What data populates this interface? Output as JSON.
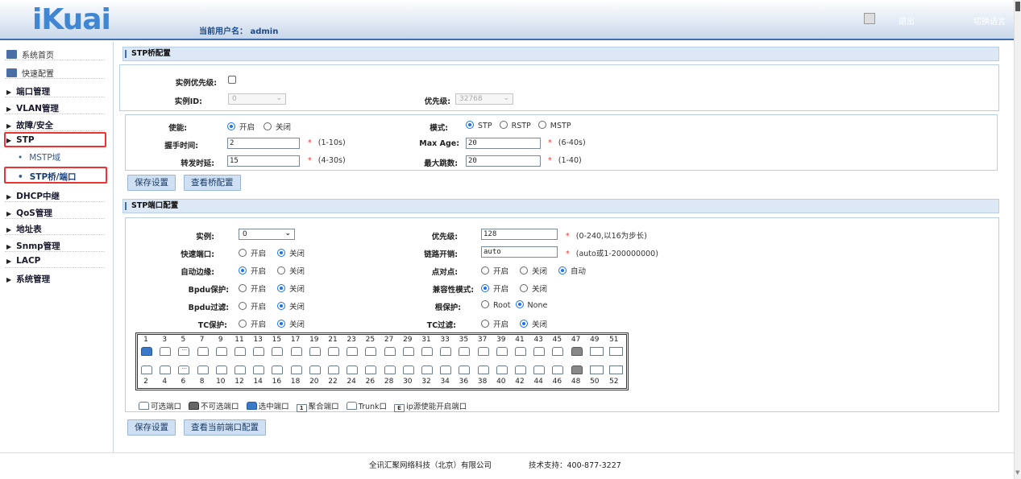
{
  "header": {
    "logo": "iKuai",
    "user_label": "当前用户名： admin",
    "exit": "退出",
    "lang": "切换语言"
  },
  "sidebar": {
    "top": [
      {
        "label": "系统首页"
      },
      {
        "label": "快速配置"
      }
    ],
    "groups": [
      {
        "label": "端口管理"
      },
      {
        "label": "VLAN管理"
      },
      {
        "label": "故障/安全"
      },
      {
        "label": "STP"
      },
      {
        "label": "DHCP中继"
      },
      {
        "label": "QoS管理"
      },
      {
        "label": "地址表"
      },
      {
        "label": "Snmp管理"
      },
      {
        "label": "LACP"
      },
      {
        "label": "系统管理"
      }
    ],
    "stp_sub": [
      {
        "label": "MSTP域"
      },
      {
        "label": "STP桥/端口"
      }
    ]
  },
  "bridge": {
    "title": "STP桥配置",
    "inst_priority_label": "实例优先级:",
    "inst_id_label": "实例ID:",
    "inst_id_value": "0",
    "priority_label": "优先级:",
    "priority_value": "32768",
    "enable_label": "使能:",
    "enable_on": "开启",
    "enable_off": "关闭",
    "mode_label": "模式:",
    "mode_stp": "STP",
    "mode_rstp": "RSTP",
    "mode_mstp": "MSTP",
    "hello_label": "握手时间:",
    "hello_value": "2",
    "hello_range": "(1-10s)",
    "maxage_label": "Max Age:",
    "maxage_value": "20",
    "maxage_range": "(6-40s)",
    "fwd_label": "转发时延:",
    "fwd_value": "15",
    "fwd_range": "(4-30s)",
    "hops_label": "最大跳数:",
    "hops_value": "20",
    "hops_range": "(1-40)",
    "save": "保存设置",
    "view": "查看桥配置"
  },
  "port": {
    "title": "STP端口配置",
    "inst_label": "实例:",
    "inst_value": "0",
    "prio_label": "优先级:",
    "prio_value": "128",
    "prio_range": "(0-240,以16为步长)",
    "fast_label": "快速端口:",
    "cost_label": "链路开销:",
    "cost_value": "auto",
    "cost_range": "(auto或1-200000000)",
    "edge_label": "自动边缘:",
    "p2p_label": "点对点:",
    "auto": "自动",
    "bpdu_guard_label": "Bpdu保护:",
    "compat_label": "兼容性模式:",
    "bpdu_filter_label": "Bpdu过滤:",
    "root_guard_label": "根保护:",
    "root": "Root",
    "none": "None",
    "tc_guard_label": "TC保护:",
    "tc_filter_label": "TC过滤:",
    "on": "开启",
    "off": "关闭",
    "top_numbers": [
      "1",
      "3",
      "5",
      "7",
      "9",
      "11",
      "13",
      "15",
      "17",
      "19",
      "21",
      "23",
      "25",
      "27",
      "29",
      "31",
      "33",
      "35",
      "37",
      "39",
      "41",
      "43",
      "45",
      "47",
      "49",
      "51"
    ],
    "bottom_numbers": [
      "2",
      "4",
      "6",
      "8",
      "10",
      "12",
      "14",
      "16",
      "18",
      "20",
      "22",
      "24",
      "26",
      "28",
      "30",
      "32",
      "34",
      "36",
      "38",
      "40",
      "42",
      "44",
      "46",
      "48",
      "50",
      "52"
    ],
    "legend": {
      "selectable": "可选端口",
      "unselectable": "不可选端口",
      "selected": "选中端口",
      "agg": "聚合端口",
      "agg_box": "1",
      "trunk": "Trunk口",
      "ip": "ip源使能开启端口",
      "ip_box": "E"
    },
    "save": "保存设置",
    "view": "查看当前端口配置"
  },
  "footer": {
    "company": "全讯汇聚网络科技（北京）有限公司",
    "support": "技术支持：400-877-3227"
  },
  "colors": {
    "accent": "#3a78c8",
    "highlight": "#e33333",
    "header_bar": "#3f6fb0"
  }
}
